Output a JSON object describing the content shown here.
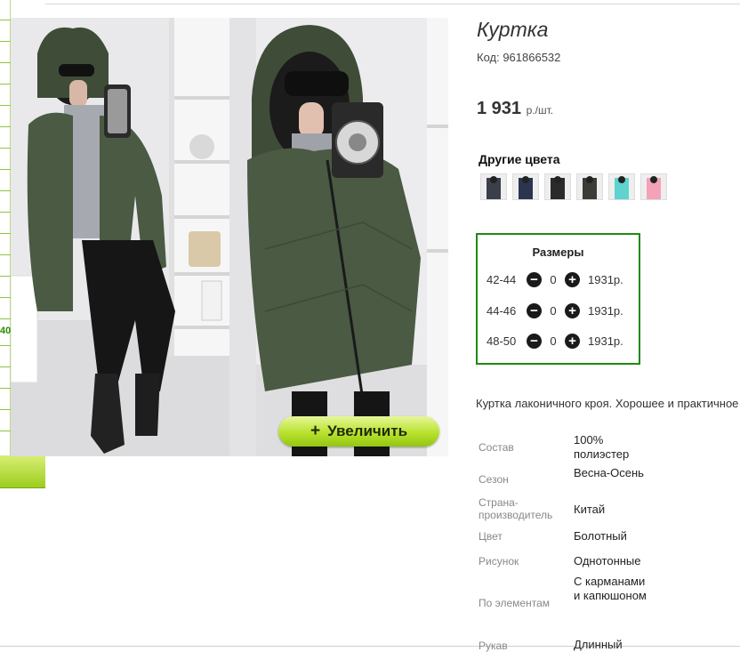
{
  "left_panel": {
    "partial_number": "40"
  },
  "product": {
    "title": "Куртка",
    "code": "Код: 961866532",
    "price": "1 931",
    "price_unit": "р./шт.",
    "zoom_button_label": "Увеличить",
    "zoom_button_icon": "plus-icon"
  },
  "other_colors": {
    "heading": "Другие цвета",
    "swatches": [
      {
        "color": "#3a3f4a"
      },
      {
        "color": "#2b3550"
      },
      {
        "color": "#2a2a2a"
      },
      {
        "color": "#3a3d35"
      },
      {
        "color": "#5ed3cf"
      },
      {
        "color": "#f3a2b8"
      }
    ]
  },
  "sizes": {
    "heading": "Размеры",
    "rows": [
      {
        "size": "42-44",
        "qty": "0",
        "price": "1931р."
      },
      {
        "size": "44-46",
        "qty": "0",
        "price": "1931р."
      },
      {
        "size": "48-50",
        "qty": "0",
        "price": "1931р."
      }
    ]
  },
  "description": "Куртка лаконичного кроя. Хорошее и практичное",
  "properties": [
    {
      "key": "Состав",
      "value": "100% полиэстер"
    },
    {
      "key": "Сезон",
      "value": "Весна-Осень"
    },
    {
      "key": "Страна-производитель",
      "value": "Китай"
    },
    {
      "key": "Цвет",
      "value": "Болотный"
    },
    {
      "key": "Рисунок",
      "value": "Однотонные"
    },
    {
      "key": "По элементам",
      "value": "С карманами и капюшоном"
    },
    {
      "key": "Рукав",
      "value": "Длинный"
    }
  ],
  "colors": {
    "accent_green": "#1e8a12",
    "button_green": "#b8e22e",
    "jacket": "#4a5a43"
  }
}
